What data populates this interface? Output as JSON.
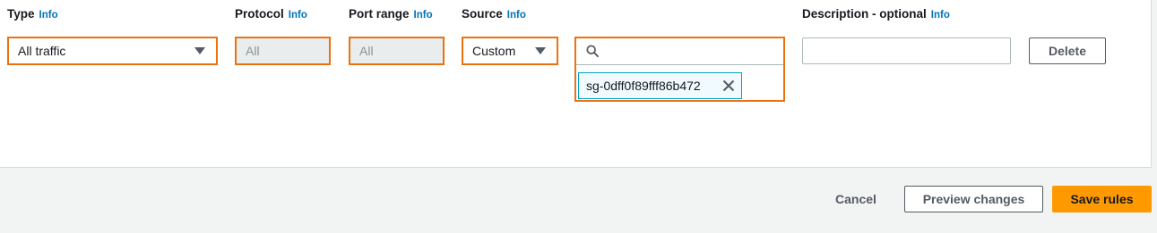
{
  "rule": {
    "type": {
      "label": "Type",
      "info": "Info",
      "value": "All traffic"
    },
    "protocol": {
      "label": "Protocol",
      "info": "Info",
      "value": "All"
    },
    "port_range": {
      "label": "Port range",
      "info": "Info",
      "value": "All"
    },
    "source": {
      "label": "Source",
      "info": "Info",
      "value": "Custom",
      "search_value": "",
      "token": "sg-0dff0f89fff86b472"
    },
    "description": {
      "label": "Description - optional",
      "info": "Info",
      "value": ""
    },
    "delete_label": "Delete"
  },
  "footer": {
    "cancel_label": "Cancel",
    "preview_label": "Preview changes",
    "save_label": "Save rules"
  },
  "colors": {
    "accent": "#ec7211",
    "primary_button": "#ff9900",
    "info_link": "#0073bb",
    "token_border": "#00a1c9"
  },
  "icons": [
    "chevron-down-icon",
    "search-icon",
    "close-icon"
  ]
}
